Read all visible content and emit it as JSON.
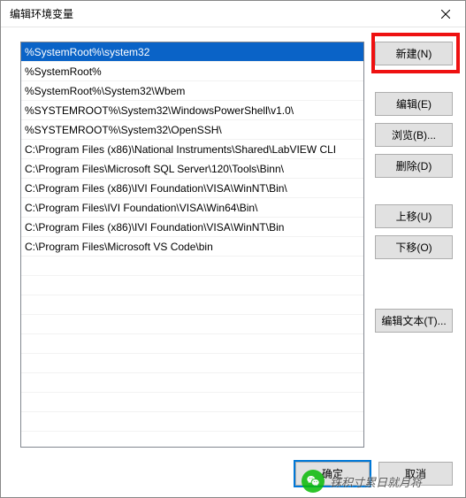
{
  "window": {
    "title": "编辑环境变量"
  },
  "list": {
    "items": [
      "%SystemRoot%\\system32",
      "%SystemRoot%",
      "%SystemRoot%\\System32\\Wbem",
      "%SYSTEMROOT%\\System32\\WindowsPowerShell\\v1.0\\",
      "%SYSTEMROOT%\\System32\\OpenSSH\\",
      "C:\\Program Files (x86)\\National Instruments\\Shared\\LabVIEW CLI",
      "C:\\Program Files\\Microsoft SQL Server\\120\\Tools\\Binn\\",
      "C:\\Program Files (x86)\\IVI Foundation\\VISA\\WinNT\\Bin\\",
      "C:\\Program Files\\IVI Foundation\\VISA\\Win64\\Bin\\",
      "C:\\Program Files (x86)\\IVI Foundation\\VISA\\WinNT\\Bin",
      "C:\\Program Files\\Microsoft VS Code\\bin"
    ],
    "selected_index": 0
  },
  "buttons": {
    "new": "新建(N)",
    "edit": "编辑(E)",
    "browse": "浏览(B)...",
    "delete": "删除(D)",
    "move_up": "上移(U)",
    "move_down": "下移(O)",
    "edit_text": "编辑文本(T)...",
    "ok": "确定",
    "cancel": "取消"
  },
  "watermark": {
    "text": "铢积寸累日就月将"
  }
}
